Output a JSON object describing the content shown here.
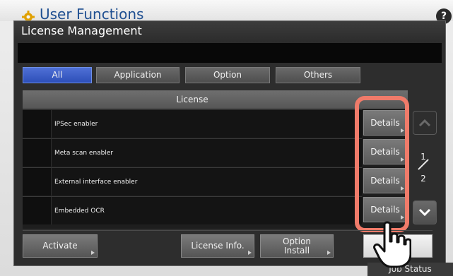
{
  "app": {
    "title": "User Functions",
    "help_label": "?",
    "job_status": "Job Status"
  },
  "dialog": {
    "title": "License Management",
    "message": "",
    "tabs": [
      {
        "label": "All",
        "active": true
      },
      {
        "label": "Application",
        "active": false
      },
      {
        "label": "Option",
        "active": false
      },
      {
        "label": "Others",
        "active": false
      }
    ],
    "list_header": "License",
    "rows": [
      {
        "label": "IPSec enabler",
        "details_label": "Details"
      },
      {
        "label": "Meta scan enabler",
        "details_label": "Details"
      },
      {
        "label": "External interface enabler",
        "details_label": "Details"
      },
      {
        "label": "Embedded OCR",
        "details_label": "Details"
      }
    ],
    "pager": {
      "current": "1",
      "total": "2"
    },
    "footer": {
      "activate": "Activate",
      "license_info": "License Info.",
      "option_install_line1": "Option",
      "option_install_line2": "Install"
    }
  },
  "colors": {
    "accent_tab": "#3d5fcf",
    "highlight": "#f07b6a"
  }
}
